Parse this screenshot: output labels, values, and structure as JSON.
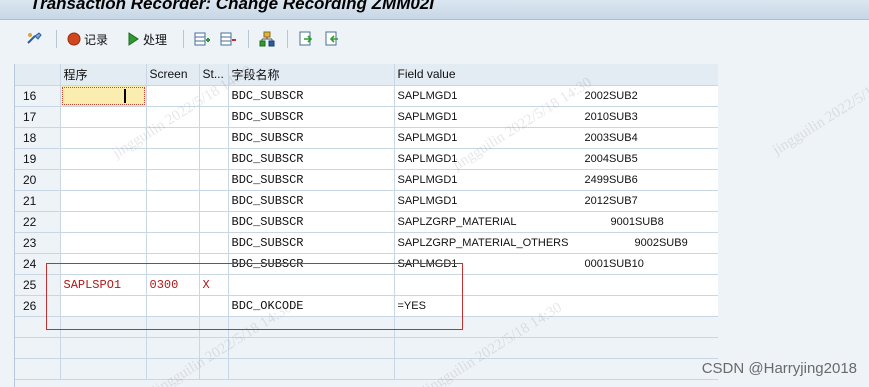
{
  "window": {
    "title": "Transaction Recorder: Change Recording ZMM02I"
  },
  "toolbar": {
    "items": [
      {
        "name": "settings-tool-icon",
        "label": ""
      },
      {
        "name": "record-button",
        "label": "记录"
      },
      {
        "name": "process-button",
        "label": "处理"
      }
    ]
  },
  "grid": {
    "headers": [
      "",
      "程序",
      "Screen",
      "St...",
      "字段名称",
      "Field value"
    ],
    "rows": [
      {
        "num": "16",
        "program": "",
        "screen": "",
        "start": "",
        "field": "BDC_SUBSCR",
        "value": "SAPLMGD1",
        "sub": "2002SUB2"
      },
      {
        "num": "17",
        "program": "",
        "screen": "",
        "start": "",
        "field": "BDC_SUBSCR",
        "value": "SAPLMGD1",
        "sub": "2010SUB3"
      },
      {
        "num": "18",
        "program": "",
        "screen": "",
        "start": "",
        "field": "BDC_SUBSCR",
        "value": "SAPLMGD1",
        "sub": "2003SUB4"
      },
      {
        "num": "19",
        "program": "",
        "screen": "",
        "start": "",
        "field": "BDC_SUBSCR",
        "value": "SAPLMGD1",
        "sub": "2004SUB5"
      },
      {
        "num": "20",
        "program": "",
        "screen": "",
        "start": "",
        "field": "BDC_SUBSCR",
        "value": "SAPLMGD1",
        "sub": "2499SUB6"
      },
      {
        "num": "21",
        "program": "",
        "screen": "",
        "start": "",
        "field": "BDC_SUBSCR",
        "value": "SAPLMGD1",
        "sub": "2012SUB7"
      },
      {
        "num": "22",
        "program": "",
        "screen": "",
        "start": "",
        "field": "BDC_SUBSCR",
        "value": "SAPLZGRP_MATERIAL",
        "sub": "9001SUB8"
      },
      {
        "num": "23",
        "program": "",
        "screen": "",
        "start": "",
        "field": "BDC_SUBSCR",
        "value": "SAPLZGRP_MATERIAL_OTHERS",
        "sub": "9002SUB9"
      },
      {
        "num": "24",
        "program": "",
        "screen": "",
        "start": "",
        "field": "BDC_SUBSCR",
        "value": "SAPLMGD1",
        "sub": "0001SUB10"
      },
      {
        "num": "25",
        "program": "SAPLSPO1",
        "screen": "0300",
        "start": "X",
        "field": "",
        "value": "",
        "sub": ""
      },
      {
        "num": "26",
        "program": "",
        "screen": "",
        "start": "",
        "field": "BDC_OKCODE",
        "value": "=YES",
        "sub": ""
      }
    ],
    "empty_rows": 3
  },
  "watermark": "jingguilin 2022/5/18 14:30",
  "credit": "CSDN @Harryjing2018"
}
